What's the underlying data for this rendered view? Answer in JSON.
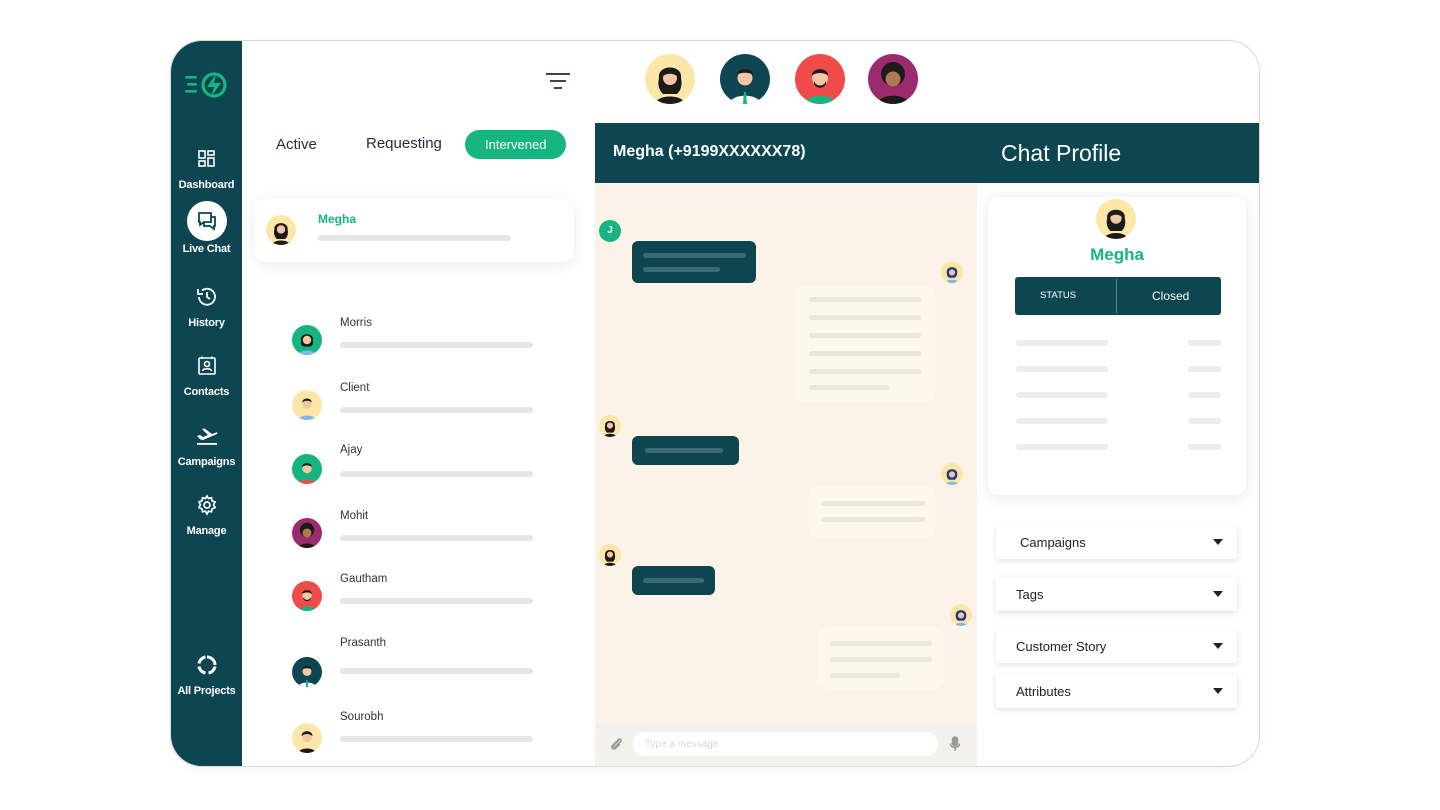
{
  "sidebar": {
    "items": [
      {
        "label": "Dashboard",
        "icon": "grid-icon"
      },
      {
        "label": "Live Chat",
        "icon": "chat-icon"
      },
      {
        "label": "History",
        "icon": "history-icon"
      },
      {
        "label": "Contacts",
        "icon": "contact-card-icon"
      },
      {
        "label": "Campaigns",
        "icon": "airplane-icon"
      },
      {
        "label": "Manage",
        "icon": "gear-icon"
      }
    ],
    "footer": {
      "label": "All Projects",
      "icon": "ring-icon"
    }
  },
  "tabs": [
    {
      "label": "Active"
    },
    {
      "label": "Requesting"
    },
    {
      "label": "Intervened"
    }
  ],
  "contacts": [
    {
      "name": "Megha"
    },
    {
      "name": "Morris"
    },
    {
      "name": "Client"
    },
    {
      "name": "Ajay"
    },
    {
      "name": "Mohit"
    },
    {
      "name": "Gautham"
    },
    {
      "name": "Prasanth"
    },
    {
      "name": "Sourobh"
    }
  ],
  "chat": {
    "title": "Megha (+9199XXXXXX78)",
    "agent_initial": "J",
    "composer_placeholder": "Type a message"
  },
  "profile": {
    "heading": "Chat Profile",
    "name": "Megha",
    "status_key": "STATUS",
    "status_value": "Closed",
    "sections": [
      "Campaigns",
      "Tags",
      "Customer Story",
      "Attributes"
    ]
  },
  "colors": {
    "brand_dark": "#0d4651",
    "accent_green": "#16b57f",
    "chat_bg": "#fbf3e7"
  }
}
